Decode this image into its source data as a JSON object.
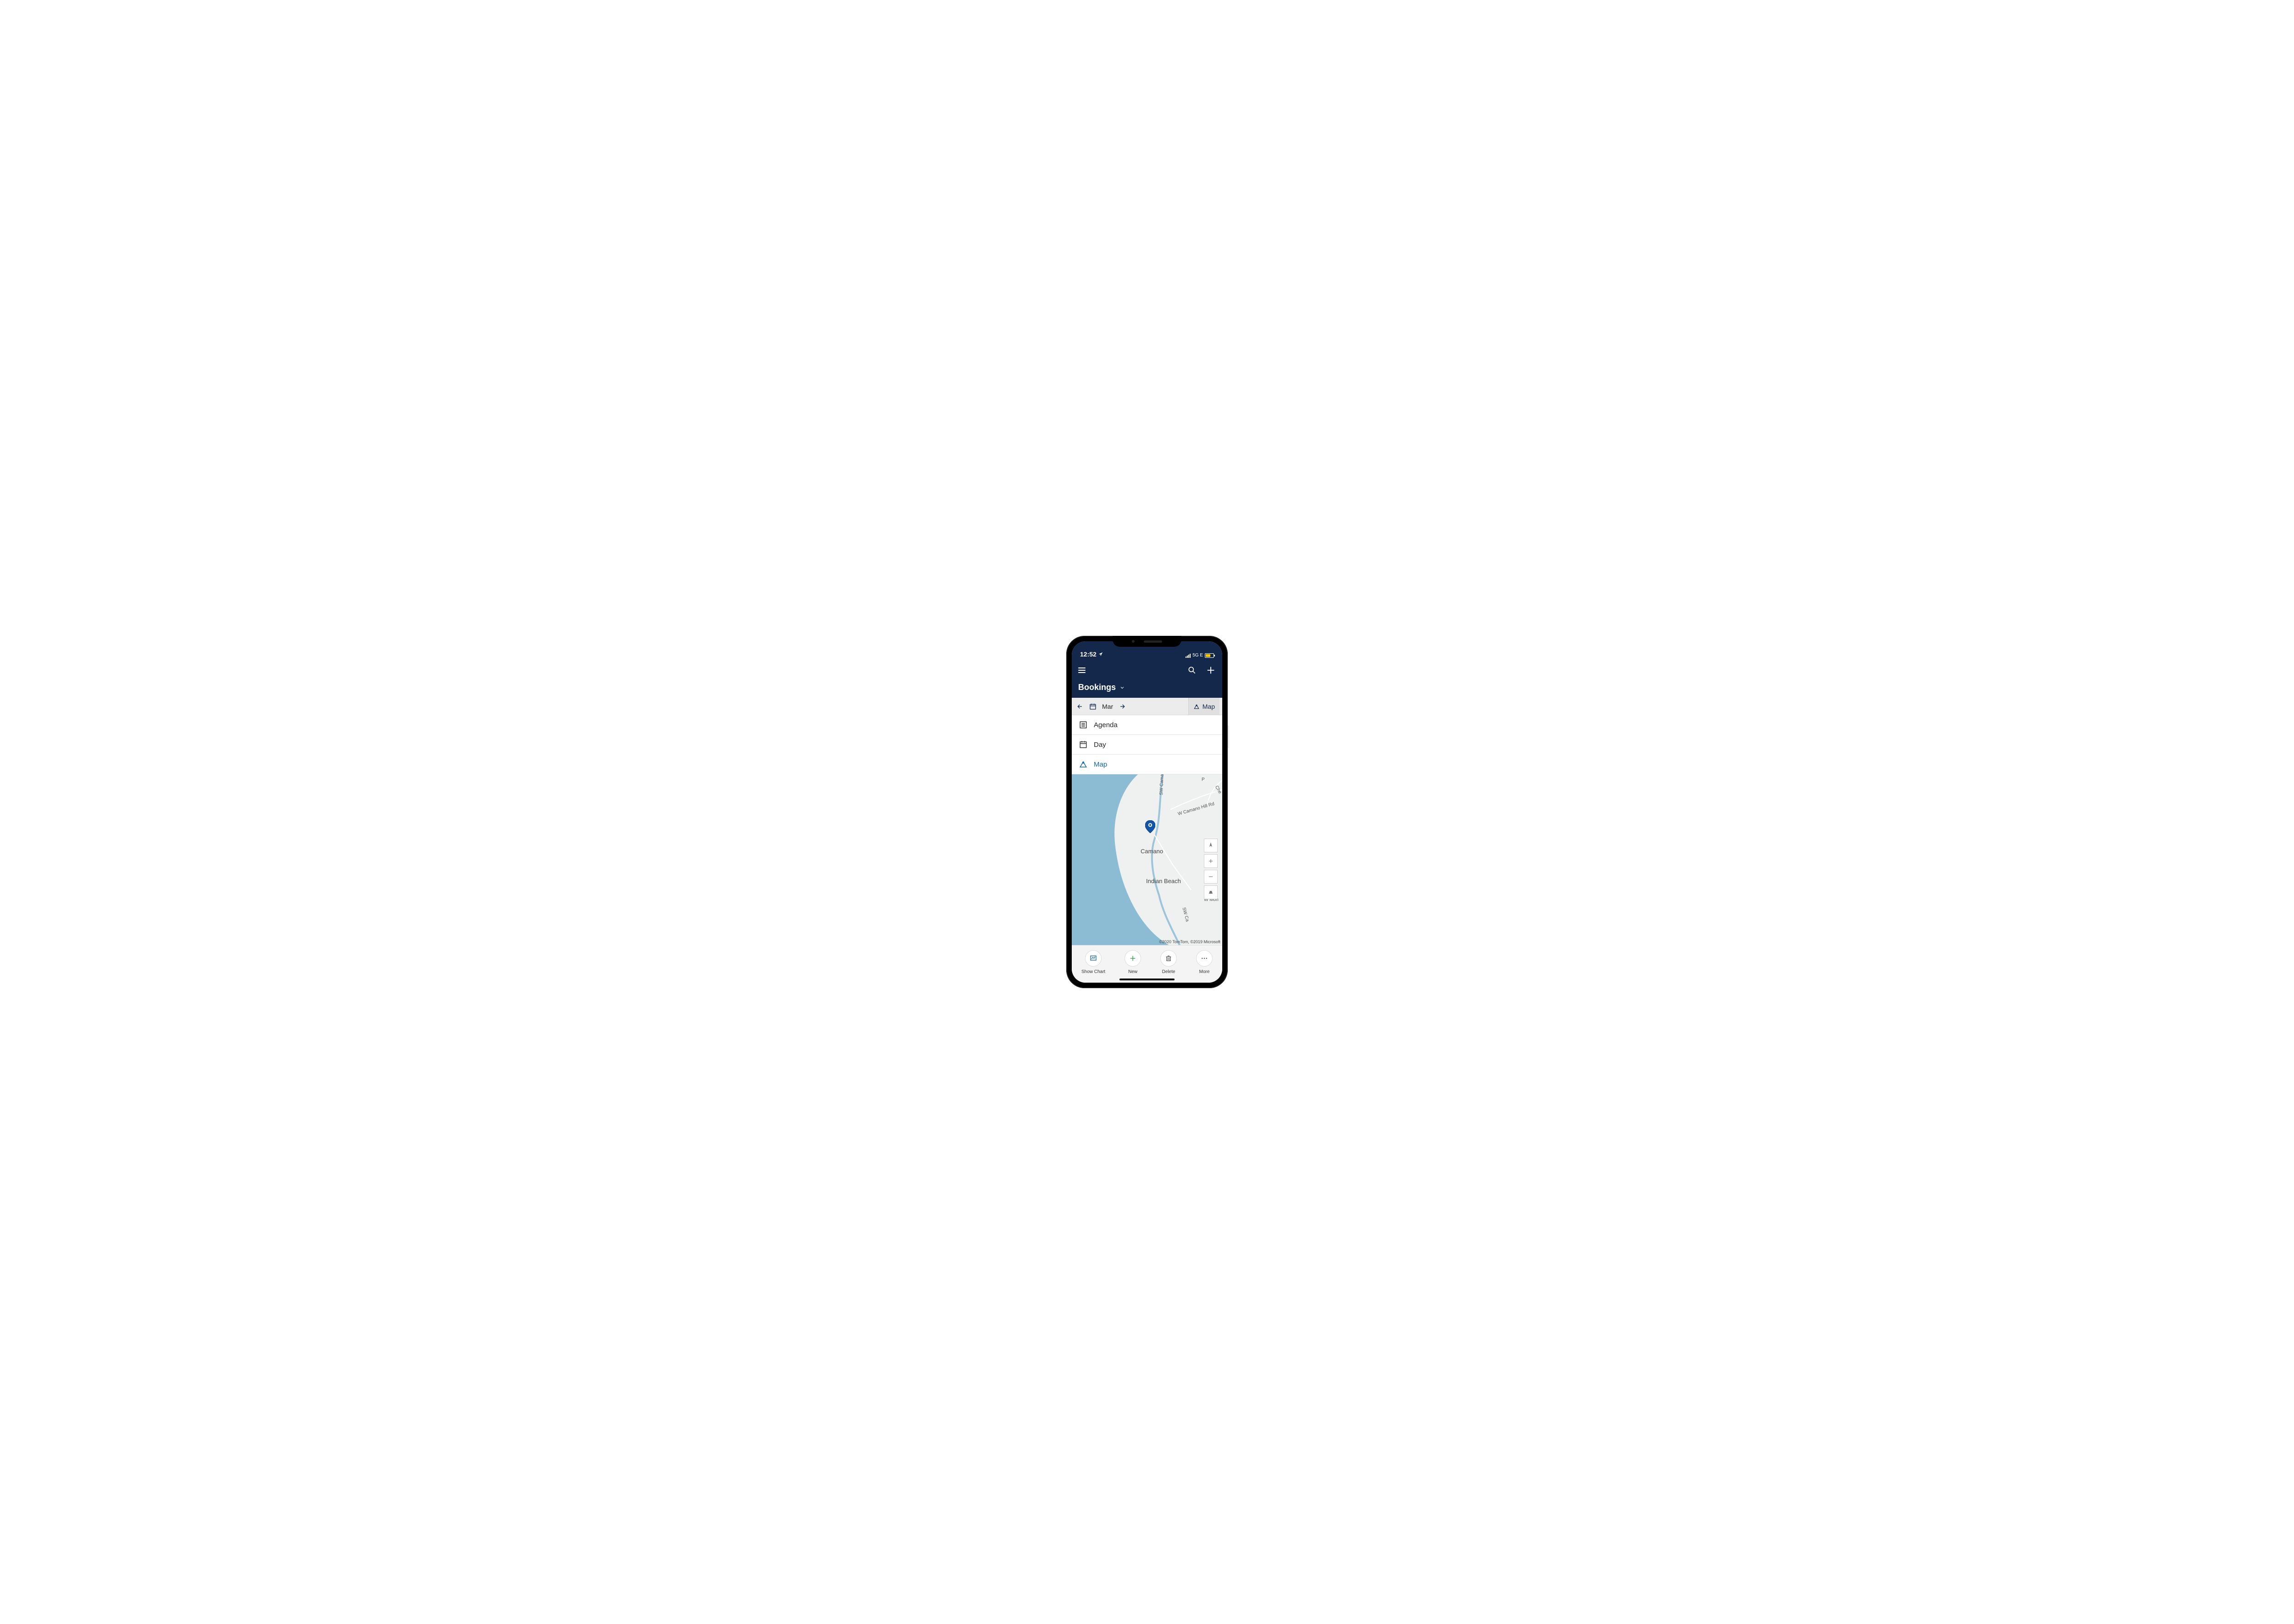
{
  "status": {
    "time": "12:52",
    "network": "5G E"
  },
  "header": {
    "title": "Bookings"
  },
  "toolbar": {
    "month": "Mar",
    "mode_label": "Map"
  },
  "view_options": {
    "agenda": "Agenda",
    "day": "Day",
    "map": "Map"
  },
  "map": {
    "places": {
      "camano": "Camano",
      "indian_beach": "Indian Beach"
    },
    "roads": {
      "sw_camano_dr": "SW Camano Dr",
      "w_camano_hill_rd": "W Camano Hill Rd",
      "cherokee": "Che",
      "sw_camano": "SW Ca",
      "w_mon": "W Mon",
      "p": "P"
    },
    "attribution": "©2020 TomTom, ©2019 Microsoft"
  },
  "bottom_bar": {
    "show_chart": "Show Chart",
    "new": "New",
    "delete": "Delete",
    "more": "More"
  }
}
